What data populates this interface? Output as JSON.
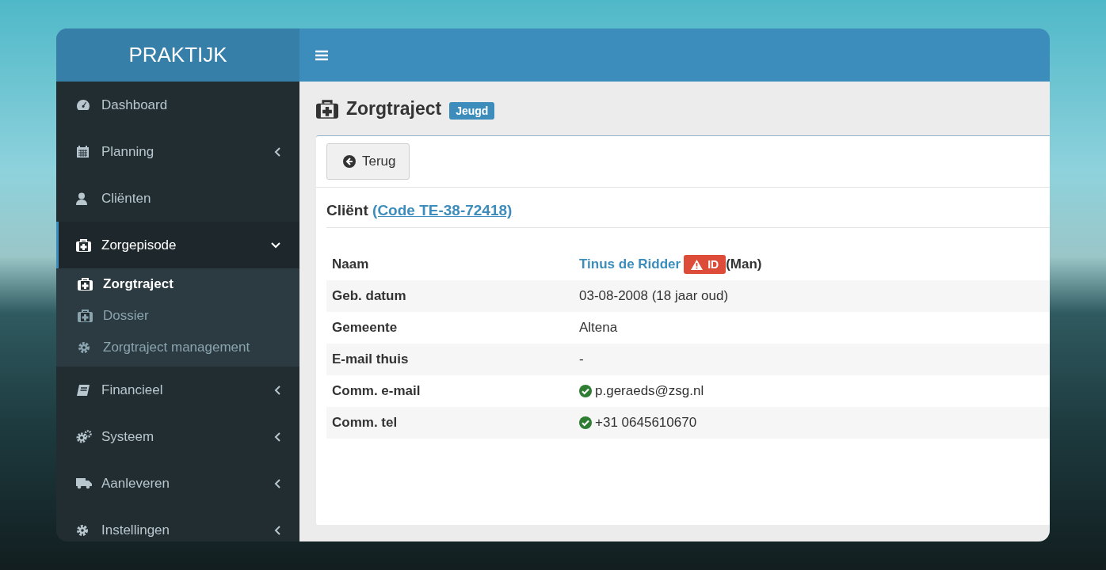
{
  "header": {
    "brand": "PRAKTIJK"
  },
  "sidebar": {
    "items": [
      {
        "label": "Dashboard",
        "kind": "link",
        "selected": false
      },
      {
        "label": "Planning",
        "kind": "menu",
        "expanded": false,
        "selected": false
      },
      {
        "label": "Cliënten",
        "kind": "link",
        "selected": false
      },
      {
        "label": "Zorgepisode",
        "kind": "menu",
        "expanded": true,
        "selected": true,
        "children": [
          {
            "label": "Zorgtraject",
            "selected": true
          },
          {
            "label": "Dossier",
            "selected": false
          },
          {
            "label": "Zorgtraject management",
            "selected": false
          }
        ]
      },
      {
        "label": "Financieel",
        "kind": "menu",
        "expanded": false,
        "selected": false
      },
      {
        "label": "Systeem",
        "kind": "menu",
        "expanded": false,
        "selected": false
      },
      {
        "label": "Aanleveren",
        "kind": "menu",
        "expanded": false,
        "selected": false
      },
      {
        "label": "Instellingen",
        "kind": "menu",
        "expanded": false,
        "selected": false
      }
    ]
  },
  "page": {
    "title": "Zorgtraject",
    "badge": "Jeugd",
    "back_button": "Terug",
    "client_label": "Cliënt",
    "client_code_link": "(Code TE-38-72418)",
    "details": [
      {
        "label": "Naam",
        "kind": "name",
        "value": "Tinus de Ridder",
        "warning_badge": "ID",
        "suffix": "(Man)"
      },
      {
        "label": "Geb. datum",
        "kind": "text",
        "value": "03-08-2008 (18 jaar oud)"
      },
      {
        "label": "Gemeente",
        "kind": "text",
        "value": "Altena"
      },
      {
        "label": "E-mail thuis",
        "kind": "text",
        "value": "-"
      },
      {
        "label": "Comm. e-mail",
        "kind": "verified",
        "value": "p.geraeds@zsg.nl"
      },
      {
        "label": "Comm. tel",
        "kind": "verified",
        "value": "+31 0645610670"
      }
    ]
  }
}
